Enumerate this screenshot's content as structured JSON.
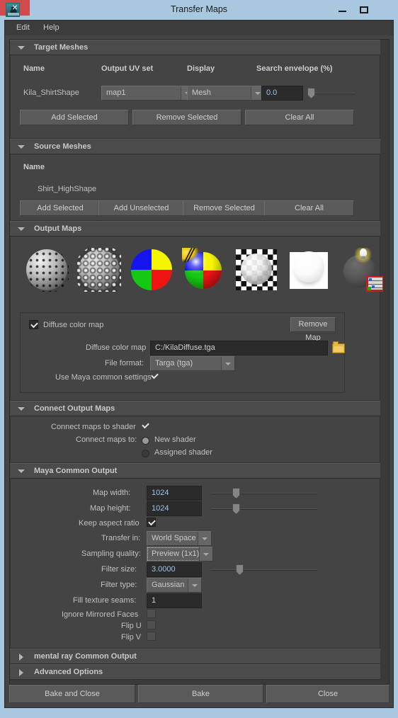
{
  "window": {
    "title": "Transfer Maps",
    "icon": "maya-app-icon",
    "controls": {
      "minimize": "minimize-button",
      "maximize": "maximize-button",
      "close": "×"
    }
  },
  "menubar": {
    "items": [
      {
        "label": "Edit"
      },
      {
        "label": "Help"
      }
    ]
  },
  "target_meshes": {
    "title": "Target Meshes",
    "expanded": true,
    "columns": [
      "Name",
      "Output UV set",
      "Display",
      "Search envelope (%)"
    ],
    "rows": [
      {
        "name": "Kila_ShirtShape",
        "uv_set": "map1",
        "display": "Mesh",
        "search_envelope": "0.0",
        "search_envelope_value": 0
      }
    ],
    "buttons": [
      "Add Selected",
      "Remove Selected",
      "Clear All"
    ]
  },
  "source_meshes": {
    "title": "Source Meshes",
    "expanded": true,
    "columns": [
      "Name"
    ],
    "rows": [
      {
        "name": "Shirt_HighShape"
      }
    ],
    "buttons": [
      "Add Selected",
      "Add Unselected",
      "Remove Selected",
      "Clear All"
    ]
  },
  "output_maps": {
    "title": "Output Maps",
    "expanded": true,
    "icons": [
      {
        "label": "Normal",
        "icon": "normal-map-icon"
      },
      {
        "label": "Displace",
        "icon": "displace-map-icon"
      },
      {
        "label": "Diffuse",
        "icon": "diffuse-map-icon"
      },
      {
        "label": "Shaded",
        "icon": "shaded-map-icon"
      },
      {
        "label": "Alpha",
        "icon": "alpha-map-icon"
      },
      {
        "label": "Ambient",
        "icon": "ambient-map-icon"
      },
      {
        "label": "Custom",
        "icon": "custom-map-icon"
      }
    ],
    "diffuse_panel": {
      "enabled_label": "Diffuse color map",
      "enabled": true,
      "remove_button": "Remove Map",
      "path_label": "Diffuse color map",
      "path_value": "C:/KilaDiffuse.tga",
      "browse_icon": "folder-icon",
      "file_format_label": "File format:",
      "file_format_value": "Targa (tga)",
      "use_common_label": "Use Maya common settings",
      "use_common": true
    }
  },
  "connect_output_maps": {
    "title": "Connect Output Maps",
    "expanded": true,
    "connect_to_shader_label": "Connect maps to shader",
    "connect_to_shader": true,
    "connect_maps_to_label": "Connect maps to:",
    "options": [
      {
        "label": "New shader",
        "selected": true
      },
      {
        "label": "Assigned shader",
        "selected": false
      }
    ]
  },
  "maya_common_output": {
    "title": "Maya Common Output",
    "expanded": true,
    "fields": [
      {
        "label": "Map width:",
        "value": "1024",
        "type": "slider-field",
        "slider_pct": 24
      },
      {
        "label": "Map height:",
        "value": "1024",
        "type": "slider-field",
        "slider_pct": 24
      },
      {
        "label": "Keep aspect ratio",
        "value": true,
        "type": "checkbox"
      },
      {
        "label": "Transfer in:",
        "value": "World Space",
        "type": "combo"
      },
      {
        "label": "Sampling quality:",
        "value": "Preview (1x1)",
        "type": "combo",
        "focused": true
      },
      {
        "label": "Filter size:",
        "value": "3.0000",
        "type": "slider-field",
        "slider_pct": 25
      },
      {
        "label": "Filter type:",
        "value": "Gaussian",
        "type": "combo"
      },
      {
        "label": "Fill texture seams:",
        "value": "1",
        "type": "field"
      },
      {
        "label": "Ignore Mirrored Faces",
        "value": false,
        "type": "checkbox"
      },
      {
        "label": "Flip U",
        "value": false,
        "type": "checkbox"
      },
      {
        "label": "Flip V",
        "value": false,
        "type": "checkbox"
      }
    ]
  },
  "mental_ray_common_output": {
    "title": "mental ray Common Output",
    "expanded": false
  },
  "advanced_options": {
    "title": "Advanced Options",
    "expanded": false
  },
  "footer": {
    "buttons": [
      "Bake and Close",
      "Bake",
      "Close"
    ]
  }
}
